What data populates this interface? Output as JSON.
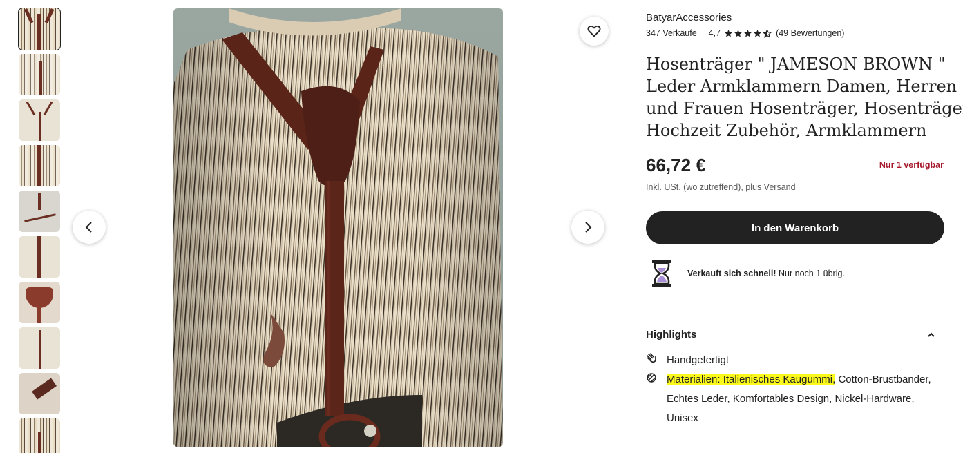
{
  "gallery": {
    "thumbnail_count": 10,
    "selected_index": 0,
    "prev_label": "previous-image",
    "next_label": "next-image"
  },
  "shop": {
    "name": "BatyarAccessories",
    "sales": "347 Verkäufe",
    "rating": "4,7",
    "rating_value": 4.7,
    "reviews": "(49 Bewertungen)"
  },
  "listing": {
    "title_lines": [
      "Hosenträger \" JAMESON BROWN \"",
      "Leder Armklammern Damen, Herren",
      "und Frauen Hosenträger, Hosenträger",
      "Hochzeit Zubehör, Armklammern"
    ],
    "price": "66,72 €",
    "stock": "Nur 1 verfügbar",
    "tax_note": "Inkl. USt. (wo zutreffend), ",
    "shipping_link": "plus Versand",
    "cart_button": "In den Warenkorb",
    "sells_fast_bold": "Verkauft sich schnell!",
    "sells_fast_rest": " Nur noch 1 übrig."
  },
  "highlights": {
    "title": "Highlights",
    "handmade": "Handgefertigt",
    "materials_highlighted": "Materialien: Italienisches Kaugummi,",
    "materials_rest": " Cotton-Brustbänder, Echtes Leder, Komfortables Design, Nickel-Hardware, Unisex"
  },
  "colors": {
    "primary_button": "#222222",
    "stock_warning": "#a61a2e",
    "highlight_marker": "#fbf81c"
  }
}
